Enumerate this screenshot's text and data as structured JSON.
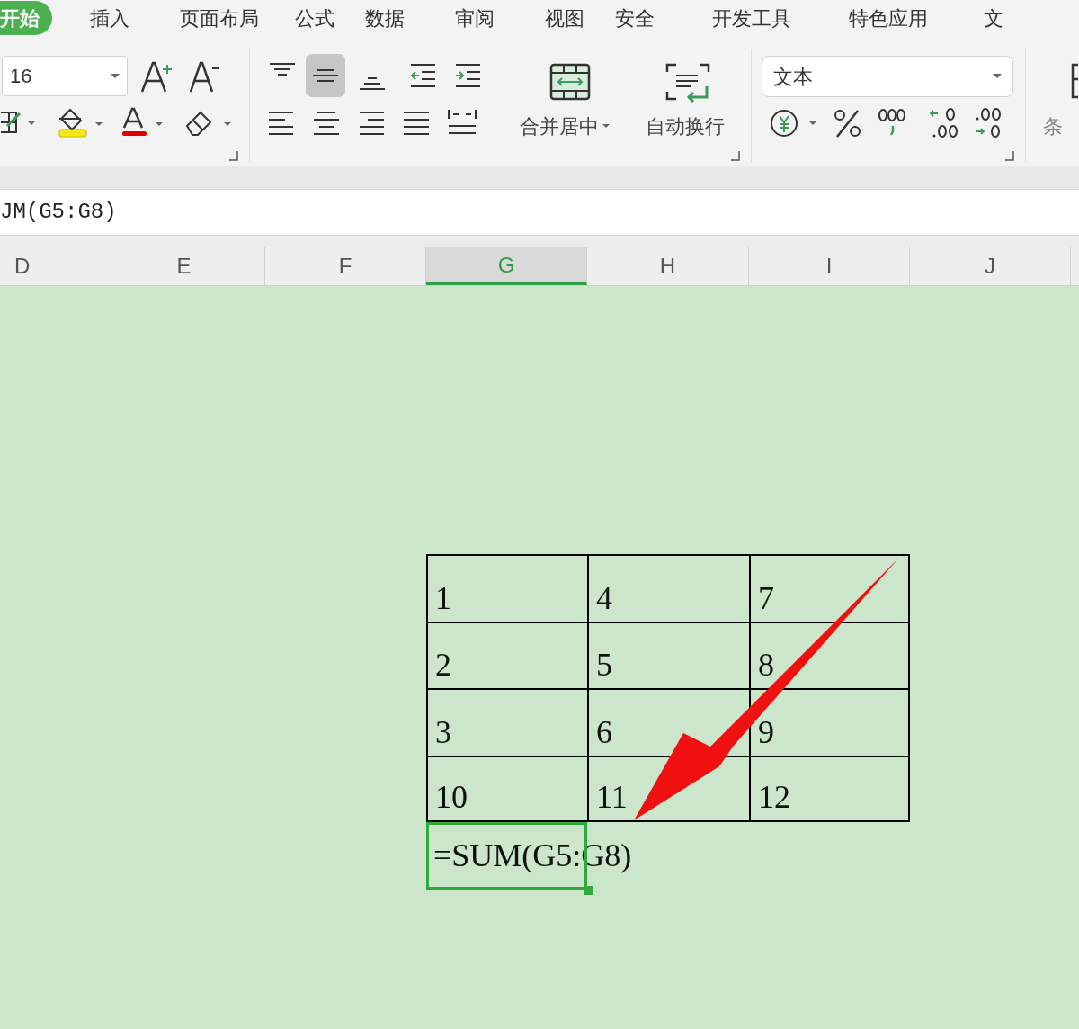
{
  "tabs": [
    {
      "label": "开始",
      "selected": true
    },
    {
      "label": "插入",
      "selected": false
    },
    {
      "label": "页面布局",
      "selected": false
    },
    {
      "label": "公式",
      "selected": false
    },
    {
      "label": "数据",
      "selected": false
    },
    {
      "label": "审阅",
      "selected": false
    },
    {
      "label": "视图",
      "selected": false
    },
    {
      "label": "安全",
      "selected": false
    },
    {
      "label": "开发工具",
      "selected": false
    },
    {
      "label": "特色应用",
      "selected": false
    },
    {
      "label": "文",
      "selected": false
    }
  ],
  "ribbon": {
    "font_size": "16",
    "vertical_align": [
      {
        "kind": "top",
        "selected": false
      },
      {
        "kind": "middle",
        "selected": true
      },
      {
        "kind": "bottom",
        "selected": false
      }
    ],
    "merge_label": "合并居中",
    "wrap_label": "自动换行",
    "number_format": "文本",
    "conditional_label": "条"
  },
  "formula_bar": {
    "value": "JM(G5:G8)"
  },
  "columns": [
    {
      "label": "D",
      "selected": false
    },
    {
      "label": "E",
      "selected": false
    },
    {
      "label": "F",
      "selected": false
    },
    {
      "label": "G",
      "selected": true
    },
    {
      "label": "H",
      "selected": false
    },
    {
      "label": "I",
      "selected": false
    },
    {
      "label": "J",
      "selected": false
    }
  ],
  "table": {
    "rows": [
      [
        "1",
        "4",
        "7"
      ],
      [
        "2",
        "5",
        "8"
      ],
      [
        "3",
        "6",
        "9"
      ],
      [
        "10",
        "11",
        "12"
      ]
    ]
  },
  "active_cell": {
    "value": "=SUM(G5:G8)"
  }
}
